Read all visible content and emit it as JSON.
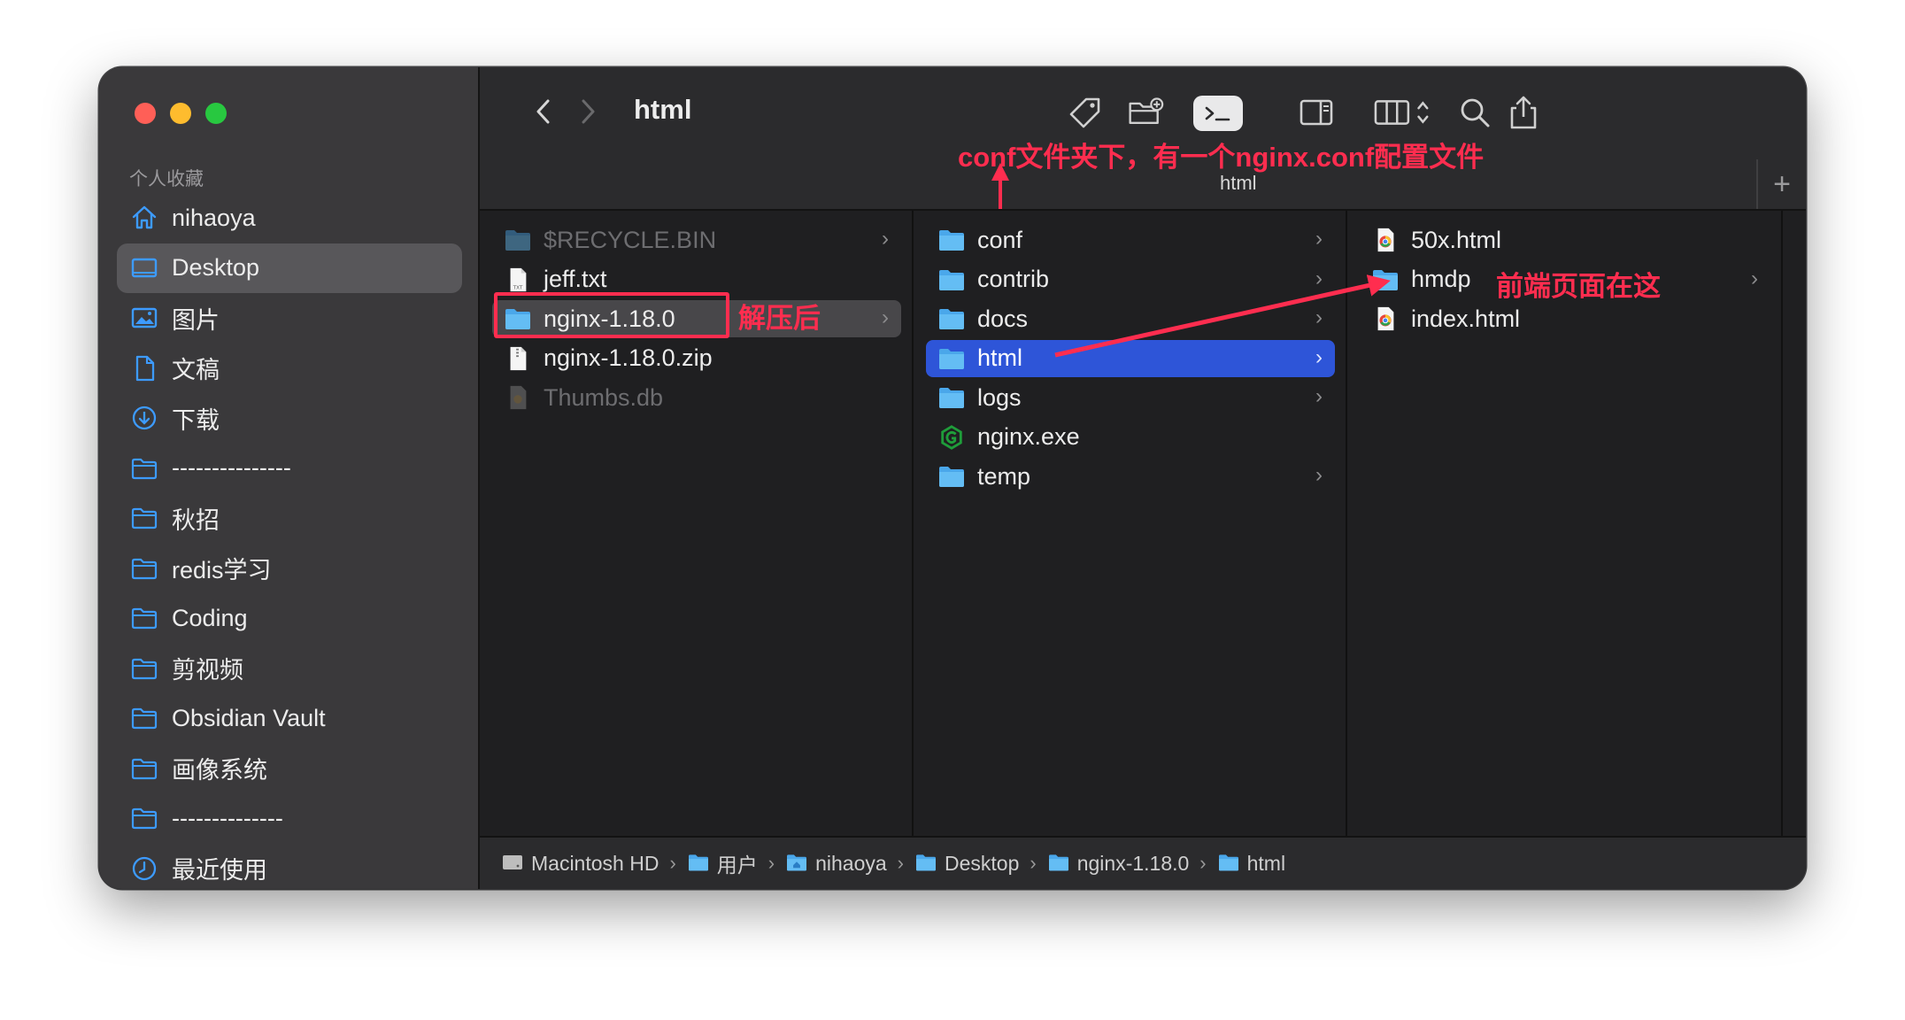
{
  "window": {
    "title": "html",
    "tab_title": "html"
  },
  "sidebar": {
    "section_title": "个人收藏",
    "items": [
      {
        "label": "nihaoya",
        "icon": "home-icon"
      },
      {
        "label": "Desktop",
        "icon": "desktop-icon",
        "active": true
      },
      {
        "label": "图片",
        "icon": "photos-icon"
      },
      {
        "label": "文稿",
        "icon": "document-icon"
      },
      {
        "label": "下载",
        "icon": "download-icon"
      },
      {
        "label": "---------------",
        "icon": "folder-icon"
      },
      {
        "label": "秋招",
        "icon": "folder-icon"
      },
      {
        "label": "redis学习",
        "icon": "folder-icon"
      },
      {
        "label": "Coding",
        "icon": "folder-icon"
      },
      {
        "label": "剪视频",
        "icon": "folder-icon"
      },
      {
        "label": "Obsidian Vault",
        "icon": "folder-icon"
      },
      {
        "label": "画像系统",
        "icon": "folder-icon"
      },
      {
        "label": "--------------",
        "icon": "folder-icon"
      },
      {
        "label": "最近使用",
        "icon": "clock-icon"
      }
    ]
  },
  "columns": {
    "col1": [
      {
        "label": "$RECYCLE.BIN",
        "icon": "folder-icon",
        "dim": true,
        "chevron": true
      },
      {
        "label": "jeff.txt",
        "icon": "text-file-icon"
      },
      {
        "label": "nginx-1.18.0",
        "icon": "folder-icon",
        "chevron": true,
        "selected": "gray"
      },
      {
        "label": "nginx-1.18.0.zip",
        "icon": "zip-file-icon"
      },
      {
        "label": "Thumbs.db",
        "icon": "db-file-icon",
        "dim": true
      }
    ],
    "col2": [
      {
        "label": "conf",
        "icon": "folder-icon",
        "chevron": true
      },
      {
        "label": "contrib",
        "icon": "folder-icon",
        "chevron": true
      },
      {
        "label": "docs",
        "icon": "folder-icon",
        "chevron": true
      },
      {
        "label": "html",
        "icon": "folder-icon",
        "chevron": true,
        "selected": "blue"
      },
      {
        "label": "logs",
        "icon": "folder-icon",
        "chevron": true
      },
      {
        "label": "nginx.exe",
        "icon": "nginx-exe-icon"
      },
      {
        "label": "temp",
        "icon": "folder-icon",
        "chevron": true
      }
    ],
    "col3": [
      {
        "label": "50x.html",
        "icon": "chrome-html-icon"
      },
      {
        "label": "hmdp",
        "icon": "folder-icon",
        "chevron": true
      },
      {
        "label": "index.html",
        "icon": "chrome-html-icon"
      }
    ]
  },
  "annotations": {
    "top": "conf文件夹下，有一个nginx.conf配置文件",
    "unzipped": "解压后",
    "frontend": "前端页面在这",
    "color": "#ff2d4f"
  },
  "pathbar": [
    {
      "label": "Macintosh HD",
      "icon": "disk-icon"
    },
    {
      "label": "用户",
      "icon": "folder-icon"
    },
    {
      "label": "nihaoya",
      "icon": "home-folder-icon"
    },
    {
      "label": "Desktop",
      "icon": "folder-icon"
    },
    {
      "label": "nginx-1.18.0",
      "icon": "folder-icon"
    },
    {
      "label": "html",
      "icon": "folder-icon"
    }
  ],
  "colors": {
    "selection_blue": "#2e55d8",
    "folder_blue": "#59b4f0",
    "sidebar_accent": "#3d9bff"
  }
}
